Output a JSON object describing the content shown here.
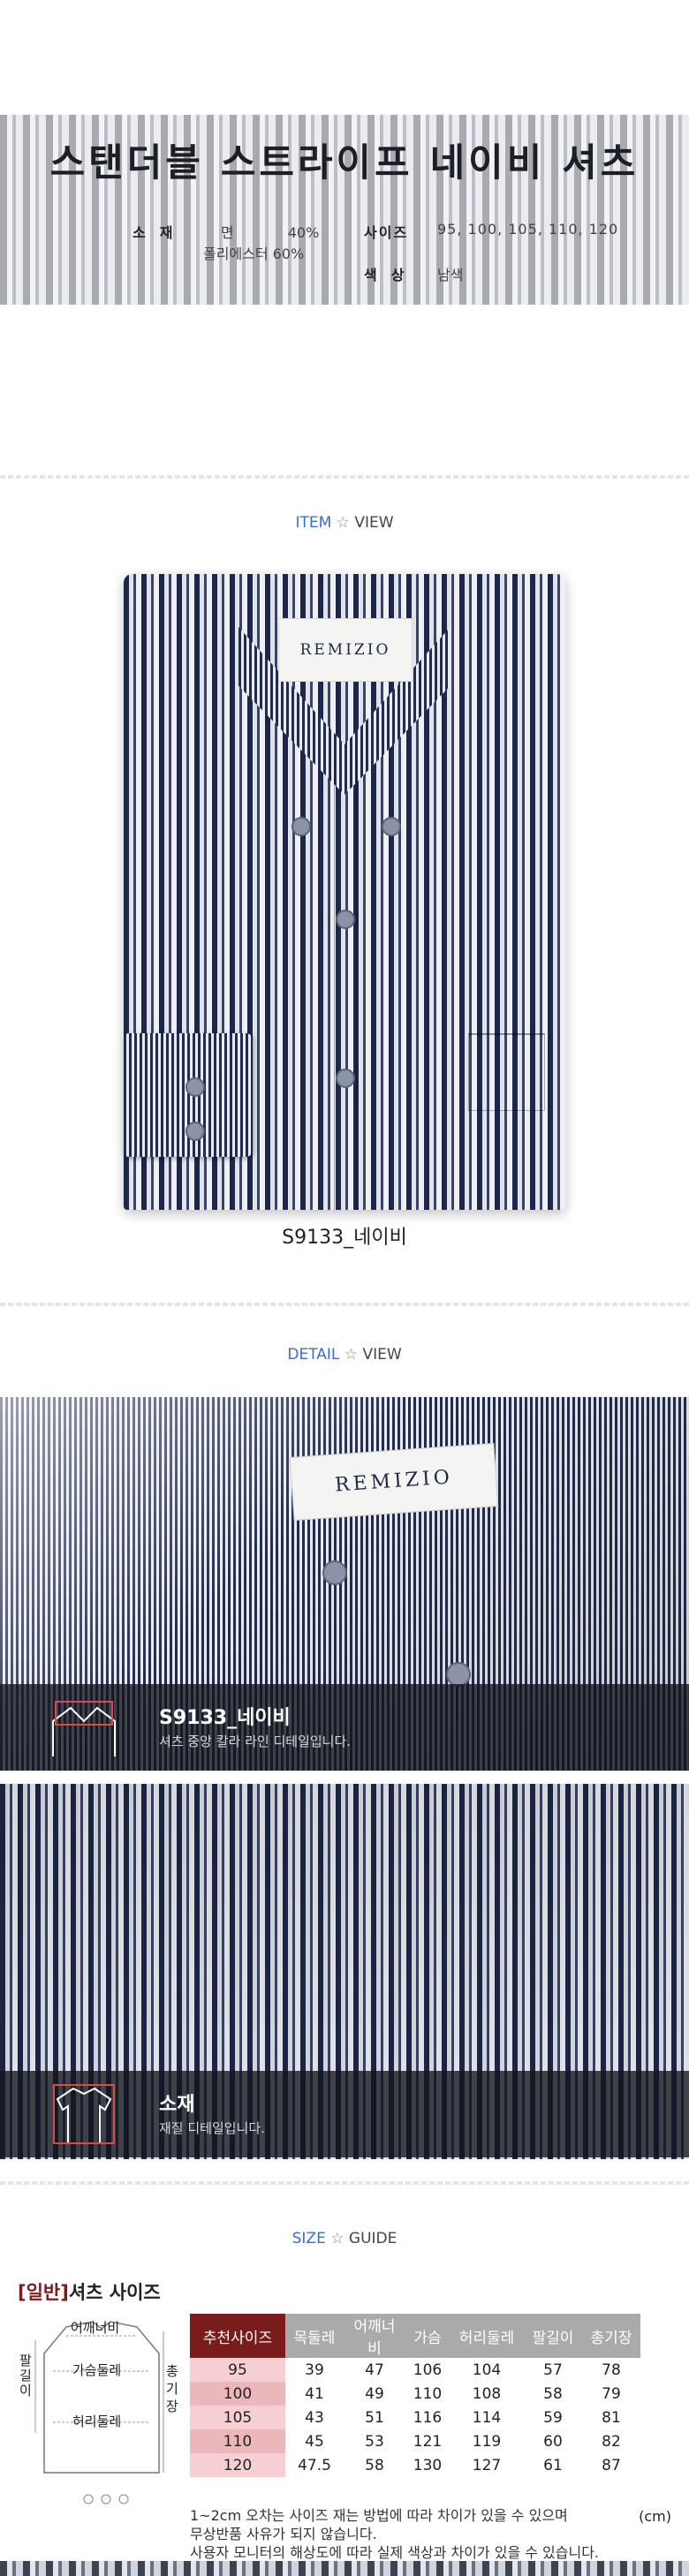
{
  "header": {
    "title": "스탠더블 스트라이프 네이비 셔츠",
    "material_label": "소재",
    "material_1": "면            40%",
    "material_2": "폴리에스터 60%",
    "size_label": "사이즈",
    "size_value": "95, 100, 105, 110, 120",
    "color_label": "색상",
    "color_value": "남색"
  },
  "item_view": {
    "heading_hl": "ITEM",
    "heading_star": "☆",
    "heading_rest": "VIEW",
    "brand_label": "REMIZIO",
    "caption": "S9133_네이비"
  },
  "detail_view": {
    "heading_hl": "DETAIL",
    "heading_star": "☆",
    "heading_rest": "VIEW",
    "brand_label": "REMIZIO",
    "collar_title": "S9133_네이비",
    "collar_desc": "셔츠 중앙 칼라 라인 디테일입니다.",
    "fabric_title": "소재",
    "fabric_desc": "재질 디테일입니다."
  },
  "size_guide": {
    "heading_hl": "SIZE",
    "heading_star": "☆",
    "heading_rest": "GUIDE",
    "title_bracket": "[일반]",
    "title_rest": "셔츠 사이즈",
    "diagram_labels": {
      "shoulder": "어깨너비",
      "chest": "가슴둘레",
      "waist": "허리둘레",
      "sleeve": "팔길이",
      "length": "총기장"
    },
    "columns": [
      "추천사이즈",
      "목둘레",
      "어깨너비",
      "가슴",
      "허리둘레",
      "팔길이",
      "총기장"
    ],
    "rows": [
      [
        "95",
        "39",
        "47",
        "106",
        "104",
        "57",
        "78"
      ],
      [
        "100",
        "41",
        "49",
        "110",
        "108",
        "58",
        "79"
      ],
      [
        "105",
        "43",
        "51",
        "116",
        "114",
        "59",
        "81"
      ],
      [
        "110",
        "45",
        "53",
        "121",
        "119",
        "60",
        "82"
      ],
      [
        "120",
        "47.5",
        "58",
        "130",
        "127",
        "61",
        "87"
      ]
    ],
    "unit": "(cm)",
    "note_1": "1~2cm 오차는 사이즈 재는 방법에 따라 차이가 있을 수 있으며",
    "note_2": "무상반품 사유가 되지 않습니다.",
    "note_3": "사용자 모니터의 해상도에 따라 실제 색상과 차이가 있을 수 있습니다."
  },
  "colors": {
    "accent_blue": "#3b6fc4",
    "table_head_red": "#7b1c1c",
    "table_row_pink": "#f5cfd2",
    "shirt_navy": "#1d2747"
  }
}
